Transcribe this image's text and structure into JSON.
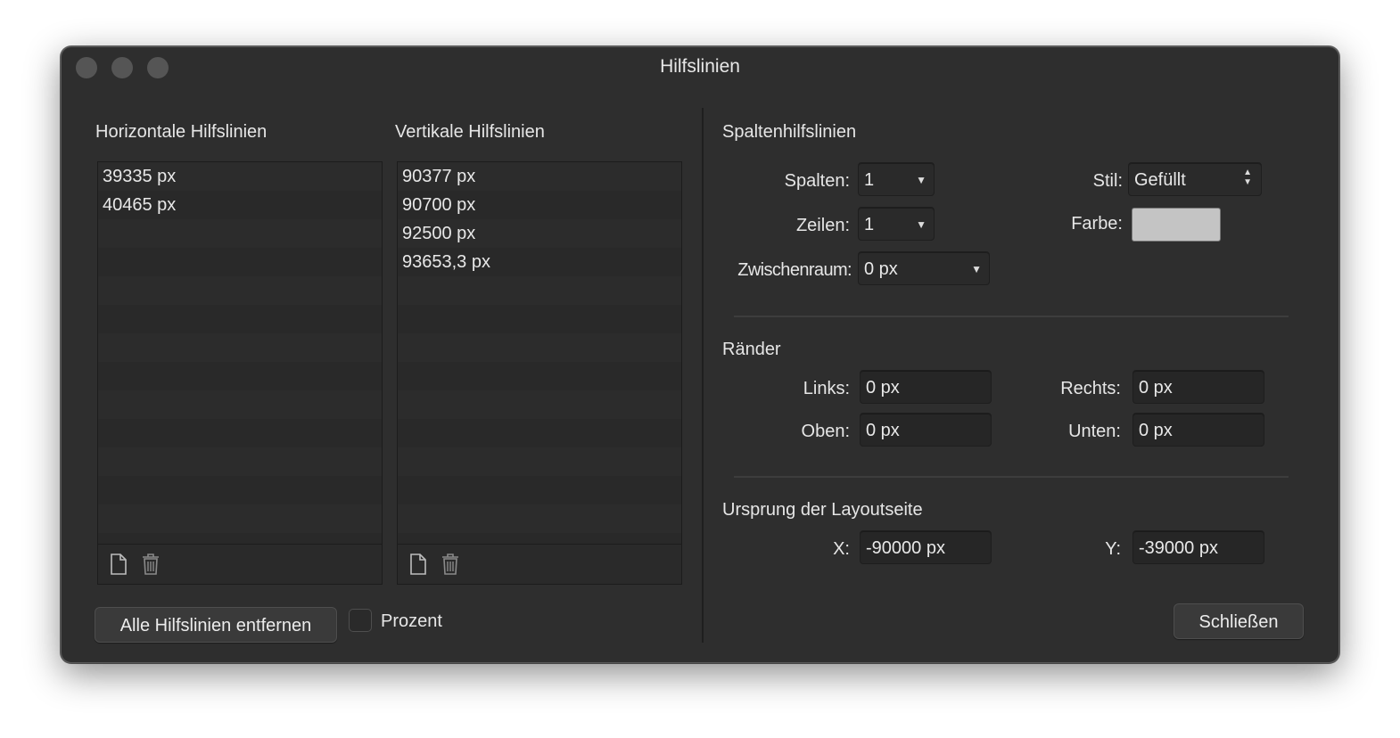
{
  "window": {
    "title": "Hilfslinien"
  },
  "horizontal": {
    "title": "Horizontale Hilfslinien",
    "items": [
      "39335 px",
      "40465 px"
    ]
  },
  "vertical": {
    "title": "Vertikale Hilfslinien",
    "items": [
      "90377 px",
      "90700 px",
      "92500 px",
      "93653,3 px"
    ]
  },
  "columns": {
    "title": "Spaltenhilfslinien",
    "columns_label": "Spalten:",
    "columns_value": "1",
    "rows_label": "Zeilen:",
    "rows_value": "1",
    "gutter_label": "Zwischenraum:",
    "gutter_value": "0 px",
    "style_label": "Stil:",
    "style_value": "Gefüllt",
    "color_label": "Farbe:",
    "color_value": "#c4c4c4"
  },
  "margins": {
    "title": "Ränder",
    "left_label": "Links:",
    "left_value": "0 px",
    "right_label": "Rechts:",
    "right_value": "0 px",
    "top_label": "Oben:",
    "top_value": "0 px",
    "bottom_label": "Unten:",
    "bottom_value": "0 px"
  },
  "origin": {
    "title": "Ursprung der Layoutseite",
    "x_label": "X:",
    "x_value": "-90000 px",
    "y_label": "Y:",
    "y_value": "-39000 px"
  },
  "footer": {
    "remove_all_label": "Alle Hilfslinien entfernen",
    "percent_label": "Prozent",
    "percent_checked": false,
    "close_label": "Schließen"
  }
}
